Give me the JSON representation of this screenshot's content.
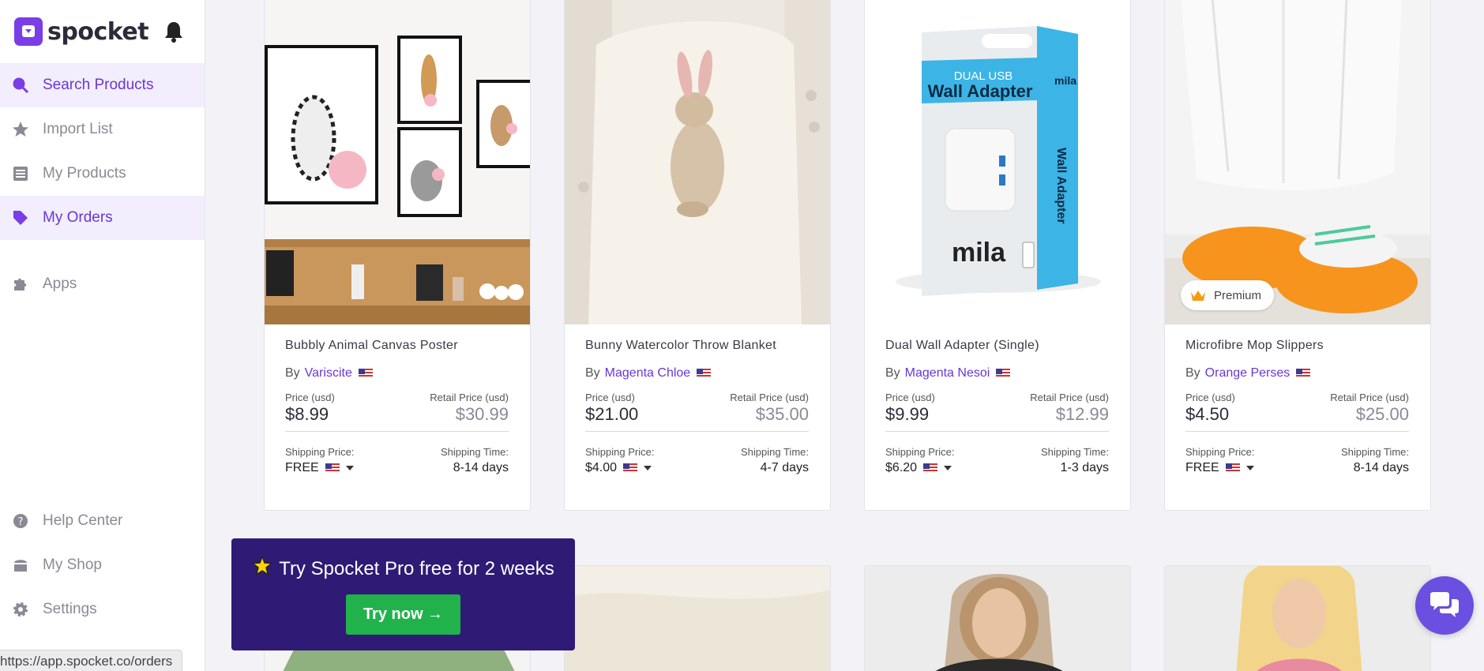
{
  "app": {
    "name": "spocket"
  },
  "sidebar": {
    "items": [
      {
        "label": "Search Products",
        "icon": "search-icon",
        "active": true
      },
      {
        "label": "Import List",
        "icon": "star-icon",
        "active": false
      },
      {
        "label": "My Products",
        "icon": "list-icon",
        "active": false
      },
      {
        "label": "My Orders",
        "icon": "tag-icon",
        "active": true
      },
      {
        "label": "Apps",
        "icon": "puzzle-icon",
        "active": false
      }
    ],
    "bottom_items": [
      {
        "label": "Help Center",
        "icon": "question-icon"
      },
      {
        "label": "My Shop",
        "icon": "shop-icon"
      },
      {
        "label": "Settings",
        "icon": "gear-icon"
      }
    ]
  },
  "status_bar": {
    "url": "https://app.spocket.co/orders"
  },
  "labels": {
    "by": "By",
    "price": "Price (usd)",
    "retail": "Retail Price (usd)",
    "shipping_price": "Shipping Price:",
    "shipping_time": "Shipping Time:",
    "premium": "Premium"
  },
  "products": [
    {
      "title": "Bubbly Animal Canvas Poster",
      "supplier": "Variscite",
      "price": "$8.99",
      "retail": "$30.99",
      "shipping_price": "FREE",
      "shipping_time": "8-14 days"
    },
    {
      "title": "Bunny Watercolor Throw Blanket",
      "supplier": "Magenta Chloe",
      "price": "$21.00",
      "retail": "$35.00",
      "shipping_price": "$4.00",
      "shipping_time": "4-7 days"
    },
    {
      "title": "Dual Wall Adapter (Single)",
      "supplier": "Magenta Nesoi",
      "price": "$9.99",
      "retail": "$12.99",
      "shipping_price": "$6.20",
      "shipping_time": "1-3 days"
    },
    {
      "title": "Microfibre Mop Slippers",
      "supplier": "Orange Perses",
      "price": "$4.50",
      "retail": "$25.00",
      "shipping_price": "FREE",
      "shipping_time": "8-14 days",
      "premium": true
    }
  ],
  "product_image_text": {
    "adapter_top": "DUAL USB",
    "adapter_main": "Wall Adapter",
    "adapter_side": "Wall Adapter",
    "adapter_brand": "mila"
  },
  "promo": {
    "text": "Try Spocket Pro free for 2 weeks",
    "button": "Try now →"
  },
  "colors": {
    "accent": "#6a36d9",
    "promo_bg": "#2f1b75",
    "cta": "#22b24c"
  }
}
